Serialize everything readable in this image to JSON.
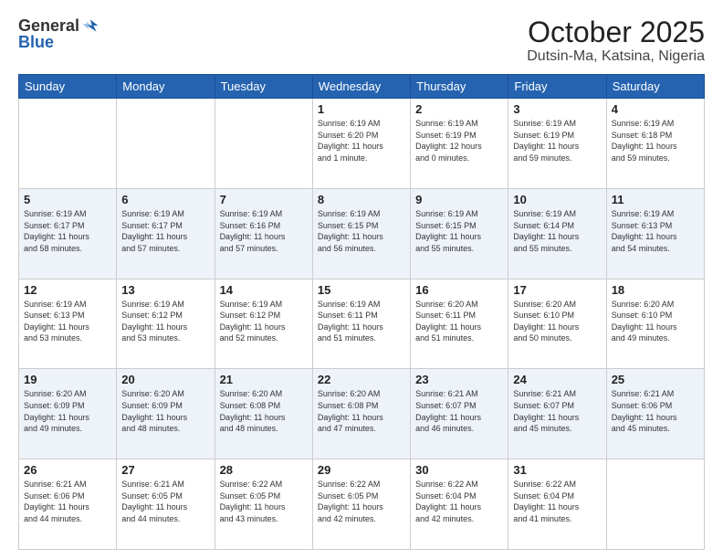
{
  "logo": {
    "general": "General",
    "blue": "Blue"
  },
  "title": "October 2025",
  "subtitle": "Dutsin-Ma, Katsina, Nigeria",
  "headers": [
    "Sunday",
    "Monday",
    "Tuesday",
    "Wednesday",
    "Thursday",
    "Friday",
    "Saturday"
  ],
  "weeks": [
    [
      {
        "day": "",
        "info": ""
      },
      {
        "day": "",
        "info": ""
      },
      {
        "day": "",
        "info": ""
      },
      {
        "day": "1",
        "info": "Sunrise: 6:19 AM\nSunset: 6:20 PM\nDaylight: 11 hours\nand 1 minute."
      },
      {
        "day": "2",
        "info": "Sunrise: 6:19 AM\nSunset: 6:19 PM\nDaylight: 12 hours\nand 0 minutes."
      },
      {
        "day": "3",
        "info": "Sunrise: 6:19 AM\nSunset: 6:19 PM\nDaylight: 11 hours\nand 59 minutes."
      },
      {
        "day": "4",
        "info": "Sunrise: 6:19 AM\nSunset: 6:18 PM\nDaylight: 11 hours\nand 59 minutes."
      }
    ],
    [
      {
        "day": "5",
        "info": "Sunrise: 6:19 AM\nSunset: 6:17 PM\nDaylight: 11 hours\nand 58 minutes."
      },
      {
        "day": "6",
        "info": "Sunrise: 6:19 AM\nSunset: 6:17 PM\nDaylight: 11 hours\nand 57 minutes."
      },
      {
        "day": "7",
        "info": "Sunrise: 6:19 AM\nSunset: 6:16 PM\nDaylight: 11 hours\nand 57 minutes."
      },
      {
        "day": "8",
        "info": "Sunrise: 6:19 AM\nSunset: 6:15 PM\nDaylight: 11 hours\nand 56 minutes."
      },
      {
        "day": "9",
        "info": "Sunrise: 6:19 AM\nSunset: 6:15 PM\nDaylight: 11 hours\nand 55 minutes."
      },
      {
        "day": "10",
        "info": "Sunrise: 6:19 AM\nSunset: 6:14 PM\nDaylight: 11 hours\nand 55 minutes."
      },
      {
        "day": "11",
        "info": "Sunrise: 6:19 AM\nSunset: 6:13 PM\nDaylight: 11 hours\nand 54 minutes."
      }
    ],
    [
      {
        "day": "12",
        "info": "Sunrise: 6:19 AM\nSunset: 6:13 PM\nDaylight: 11 hours\nand 53 minutes."
      },
      {
        "day": "13",
        "info": "Sunrise: 6:19 AM\nSunset: 6:12 PM\nDaylight: 11 hours\nand 53 minutes."
      },
      {
        "day": "14",
        "info": "Sunrise: 6:19 AM\nSunset: 6:12 PM\nDaylight: 11 hours\nand 52 minutes."
      },
      {
        "day": "15",
        "info": "Sunrise: 6:19 AM\nSunset: 6:11 PM\nDaylight: 11 hours\nand 51 minutes."
      },
      {
        "day": "16",
        "info": "Sunrise: 6:20 AM\nSunset: 6:11 PM\nDaylight: 11 hours\nand 51 minutes."
      },
      {
        "day": "17",
        "info": "Sunrise: 6:20 AM\nSunset: 6:10 PM\nDaylight: 11 hours\nand 50 minutes."
      },
      {
        "day": "18",
        "info": "Sunrise: 6:20 AM\nSunset: 6:10 PM\nDaylight: 11 hours\nand 49 minutes."
      }
    ],
    [
      {
        "day": "19",
        "info": "Sunrise: 6:20 AM\nSunset: 6:09 PM\nDaylight: 11 hours\nand 49 minutes."
      },
      {
        "day": "20",
        "info": "Sunrise: 6:20 AM\nSunset: 6:09 PM\nDaylight: 11 hours\nand 48 minutes."
      },
      {
        "day": "21",
        "info": "Sunrise: 6:20 AM\nSunset: 6:08 PM\nDaylight: 11 hours\nand 48 minutes."
      },
      {
        "day": "22",
        "info": "Sunrise: 6:20 AM\nSunset: 6:08 PM\nDaylight: 11 hours\nand 47 minutes."
      },
      {
        "day": "23",
        "info": "Sunrise: 6:21 AM\nSunset: 6:07 PM\nDaylight: 11 hours\nand 46 minutes."
      },
      {
        "day": "24",
        "info": "Sunrise: 6:21 AM\nSunset: 6:07 PM\nDaylight: 11 hours\nand 45 minutes."
      },
      {
        "day": "25",
        "info": "Sunrise: 6:21 AM\nSunset: 6:06 PM\nDaylight: 11 hours\nand 45 minutes."
      }
    ],
    [
      {
        "day": "26",
        "info": "Sunrise: 6:21 AM\nSunset: 6:06 PM\nDaylight: 11 hours\nand 44 minutes."
      },
      {
        "day": "27",
        "info": "Sunrise: 6:21 AM\nSunset: 6:05 PM\nDaylight: 11 hours\nand 44 minutes."
      },
      {
        "day": "28",
        "info": "Sunrise: 6:22 AM\nSunset: 6:05 PM\nDaylight: 11 hours\nand 43 minutes."
      },
      {
        "day": "29",
        "info": "Sunrise: 6:22 AM\nSunset: 6:05 PM\nDaylight: 11 hours\nand 42 minutes."
      },
      {
        "day": "30",
        "info": "Sunrise: 6:22 AM\nSunset: 6:04 PM\nDaylight: 11 hours\nand 42 minutes."
      },
      {
        "day": "31",
        "info": "Sunrise: 6:22 AM\nSunset: 6:04 PM\nDaylight: 11 hours\nand 41 minutes."
      },
      {
        "day": "",
        "info": ""
      }
    ]
  ]
}
